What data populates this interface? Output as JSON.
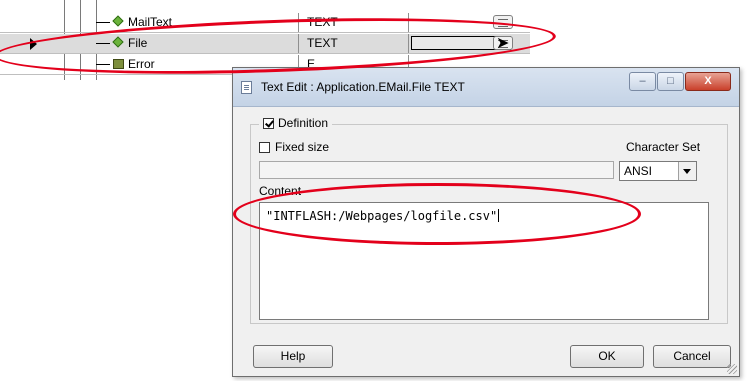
{
  "tree": {
    "rows": [
      {
        "name": "MailText",
        "type": "TEXT",
        "icon": "diamond-icon",
        "selected": false
      },
      {
        "name": "File",
        "type": "TEXT",
        "icon": "diamond-icon",
        "selected": true
      },
      {
        "name": "Error",
        "type": "E",
        "icon": "error-icon",
        "selected": false
      }
    ]
  },
  "dialog": {
    "title": "Text Edit : Application.EMail.File TEXT",
    "window_buttons": {
      "minimize": "–",
      "maximize": "□",
      "close": "X"
    },
    "definition_label": "Definition",
    "definition_checked": true,
    "fixed_size_label": "Fixed size",
    "fixed_size_checked": false,
    "charset_label": "Character Set",
    "charset_value": "ANSI",
    "content_label": "Content",
    "content_value": "\"INTFLASH:/Webpages/logfile.csv\"",
    "help_label": "Help",
    "ok_label": "OK",
    "cancel_label": "Cancel"
  },
  "colors": {
    "annotation": "#e3001b",
    "titlebar": "#c4d3e6",
    "close_button": "#c9402b"
  }
}
